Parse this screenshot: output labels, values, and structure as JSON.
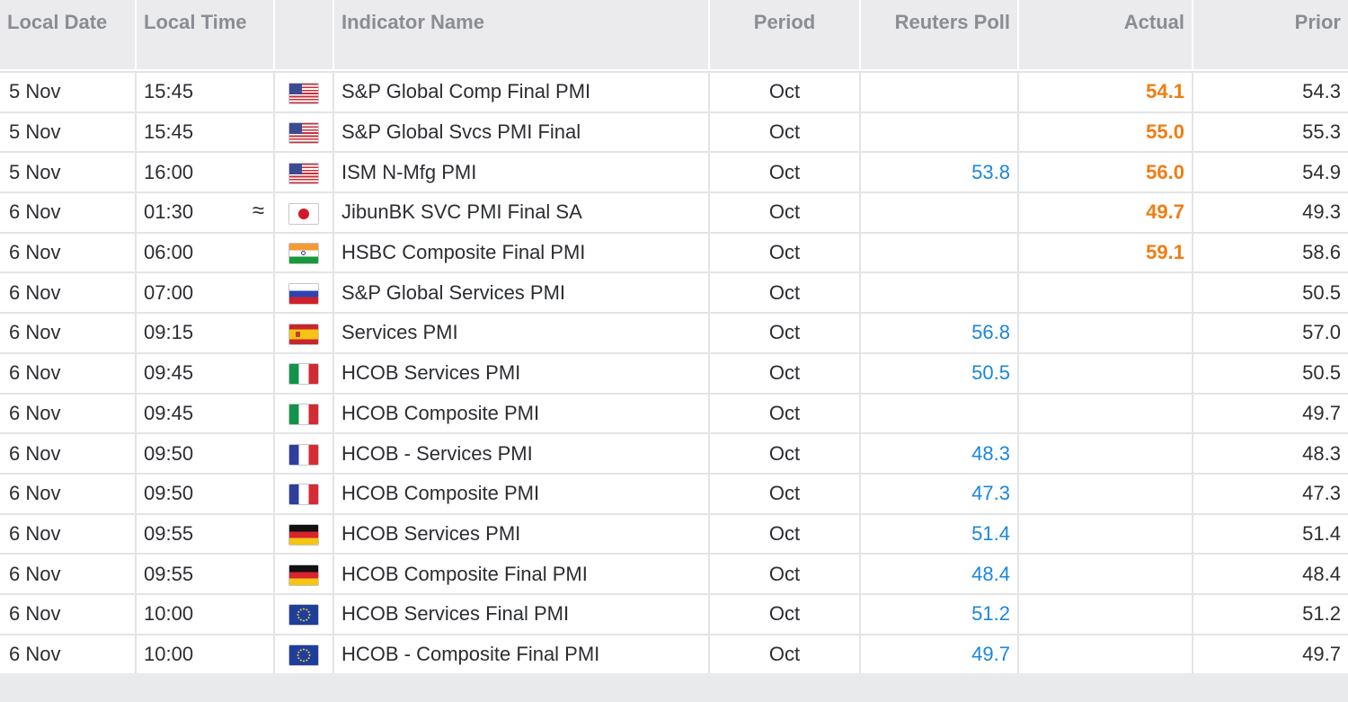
{
  "headers": {
    "local_date": "Local Date",
    "local_time": "Local Time",
    "flag": "",
    "indicator_name": "Indicator Name",
    "period": "Period",
    "reuters_poll": "Reuters Poll",
    "actual": "Actual",
    "prior": "Prior"
  },
  "colors": {
    "poll_blue": "#1a86dc",
    "actual_orange": "#f07d12",
    "header_bg": "#ebebed",
    "row_bg": "#ffffff"
  },
  "rows": [
    {
      "date": "5 Nov",
      "time": "15:45",
      "approx": "",
      "flag": "us-flag-icon",
      "name": "S&P Global Comp Final PMI",
      "period": "Oct",
      "poll": "",
      "actual": "54.1",
      "prior": "54.3"
    },
    {
      "date": "5 Nov",
      "time": "15:45",
      "approx": "",
      "flag": "us-flag-icon",
      "name": "S&P Global Svcs PMI Final",
      "period": "Oct",
      "poll": "",
      "actual": "55.0",
      "prior": "55.3"
    },
    {
      "date": "5 Nov",
      "time": "16:00",
      "approx": "",
      "flag": "us-flag-icon",
      "name": "ISM N-Mfg PMI",
      "period": "Oct",
      "poll": "53.8",
      "actual": "56.0",
      "prior": "54.9"
    },
    {
      "date": "6 Nov",
      "time": "01:30",
      "approx": "≈",
      "flag": "jp-flag-icon",
      "name": "JibunBK SVC PMI Final SA",
      "period": "Oct",
      "poll": "",
      "actual": "49.7",
      "prior": "49.3"
    },
    {
      "date": "6 Nov",
      "time": "06:00",
      "approx": "",
      "flag": "in-flag-icon",
      "name": "HSBC Composite Final PMI",
      "period": "Oct",
      "poll": "",
      "actual": "59.1",
      "prior": "58.6"
    },
    {
      "date": "6 Nov",
      "time": "07:00",
      "approx": "",
      "flag": "ru-flag-icon",
      "name": "S&P Global Services PMI",
      "period": "Oct",
      "poll": "",
      "actual": "",
      "prior": "50.5"
    },
    {
      "date": "6 Nov",
      "time": "09:15",
      "approx": "",
      "flag": "es-flag-icon",
      "name": "Services PMI",
      "period": "Oct",
      "poll": "56.8",
      "actual": "",
      "prior": "57.0"
    },
    {
      "date": "6 Nov",
      "time": "09:45",
      "approx": "",
      "flag": "it-flag-icon",
      "name": "HCOB Services PMI",
      "period": "Oct",
      "poll": "50.5",
      "actual": "",
      "prior": "50.5"
    },
    {
      "date": "6 Nov",
      "time": "09:45",
      "approx": "",
      "flag": "it-flag-icon",
      "name": "HCOB Composite PMI",
      "period": "Oct",
      "poll": "",
      "actual": "",
      "prior": "49.7"
    },
    {
      "date": "6 Nov",
      "time": "09:50",
      "approx": "",
      "flag": "fr-flag-icon",
      "name": "HCOB - Services PMI",
      "period": "Oct",
      "poll": "48.3",
      "actual": "",
      "prior": "48.3"
    },
    {
      "date": "6 Nov",
      "time": "09:50",
      "approx": "",
      "flag": "fr-flag-icon",
      "name": "HCOB Composite PMI",
      "period": "Oct",
      "poll": "47.3",
      "actual": "",
      "prior": "47.3"
    },
    {
      "date": "6 Nov",
      "time": "09:55",
      "approx": "",
      "flag": "de-flag-icon",
      "name": "HCOB Services PMI",
      "period": "Oct",
      "poll": "51.4",
      "actual": "",
      "prior": "51.4"
    },
    {
      "date": "6 Nov",
      "time": "09:55",
      "approx": "",
      "flag": "de-flag-icon",
      "name": "HCOB Composite Final PMI",
      "period": "Oct",
      "poll": "48.4",
      "actual": "",
      "prior": "48.4"
    },
    {
      "date": "6 Nov",
      "time": "10:00",
      "approx": "",
      "flag": "eu-flag-icon",
      "name": "HCOB Services Final PMI",
      "period": "Oct",
      "poll": "51.2",
      "actual": "",
      "prior": "51.2"
    },
    {
      "date": "6 Nov",
      "time": "10:00",
      "approx": "",
      "flag": "eu-flag-icon",
      "name": "HCOB - Composite Final PMI",
      "period": "Oct",
      "poll": "49.7",
      "actual": "",
      "prior": "49.7"
    }
  ]
}
